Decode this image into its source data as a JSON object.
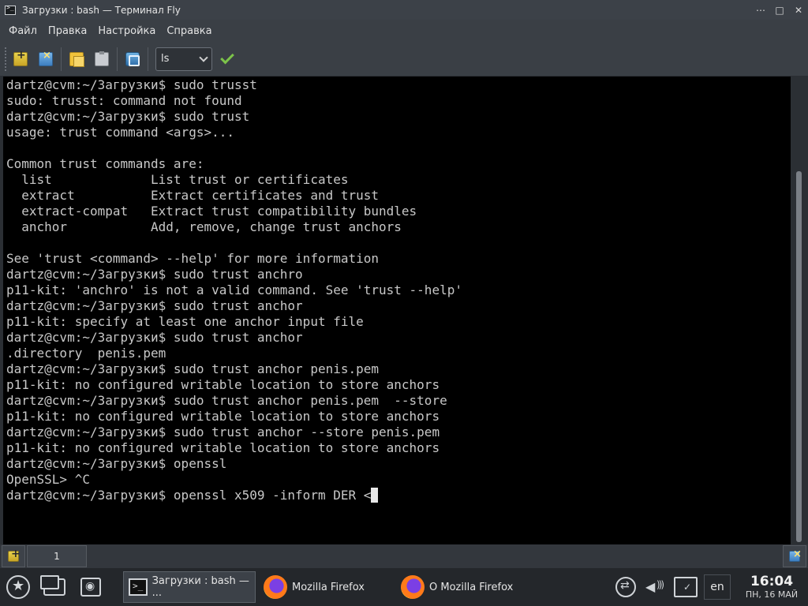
{
  "window": {
    "title": "Загрузки : bash — Терминал Fly",
    "controls": [
      "⋯",
      "□",
      "✕"
    ]
  },
  "menu": [
    "Файл",
    "Правка",
    "Настройка",
    "Справка"
  ],
  "toolbar": {
    "icons": [
      "new-tab-icon",
      "close-tab-icon",
      "copy-icon",
      "paste-icon",
      "find-icon"
    ],
    "command_select": "ls"
  },
  "terminal": {
    "lines": [
      "dartz@cvm:~/Загрузки$ sudo trusst",
      "sudo: trusst: command not found",
      "dartz@cvm:~/Загрузки$ sudo trust",
      "usage: trust command <args>...",
      "",
      "Common trust commands are:",
      "  list             List trust or certificates",
      "  extract          Extract certificates and trust",
      "  extract-compat   Extract trust compatibility bundles",
      "  anchor           Add, remove, change trust anchors",
      "",
      "See 'trust <command> --help' for more information",
      "dartz@cvm:~/Загрузки$ sudo trust anchro",
      "p11-kit: 'anchro' is not a valid command. See 'trust --help'",
      "dartz@cvm:~/Загрузки$ sudo trust anchor",
      "p11-kit: specify at least one anchor input file",
      "dartz@cvm:~/Загрузки$ sudo trust anchor",
      ".directory  penis.pem",
      "dartz@cvm:~/Загрузки$ sudo trust anchor penis.pem",
      "p11-kit: no configured writable location to store anchors",
      "dartz@cvm:~/Загрузки$ sudo trust anchor penis.pem  --store",
      "p11-kit: no configured writable location to store anchors",
      "dartz@cvm:~/Загрузки$ sudo trust anchor --store penis.pem",
      "p11-kit: no configured writable location to store anchors",
      "dartz@cvm:~/Загрузки$ openssl",
      "OpenSSL> ^C",
      "dartz@cvm:~/Загрузки$ openssl x509 -inform DER <"
    ]
  },
  "tabs": {
    "items": [
      "1"
    ]
  },
  "taskbar": {
    "tasks": [
      {
        "label": "Загрузки : bash — ...",
        "icon": "terminal-icon",
        "active": true
      },
      {
        "label": "Mozilla Firefox",
        "icon": "firefox-icon",
        "active": false
      },
      {
        "label": "O Mozilla Firefox",
        "icon": "firefox-icon",
        "active": false
      }
    ],
    "language": "en",
    "time": "16:04",
    "date": "ПН, 16 МАЙ"
  }
}
